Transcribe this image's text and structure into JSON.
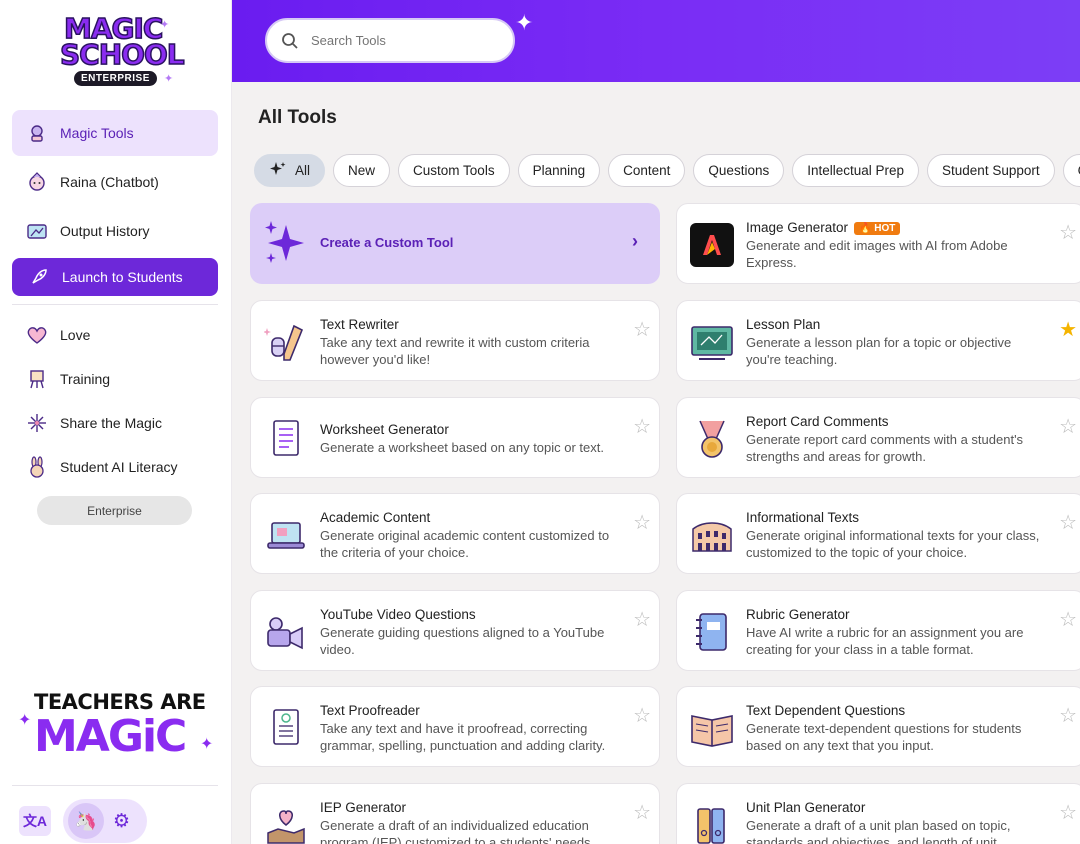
{
  "logo": {
    "line1": "MAGIC",
    "line2": "SCHOOL",
    "badge": "ENTERPRISE"
  },
  "sidebar": {
    "items": [
      {
        "label": "Magic Tools",
        "icon": "magic-tools-icon"
      },
      {
        "label": "Raina (Chatbot)",
        "icon": "raina-icon"
      },
      {
        "label": "Output History",
        "icon": "output-history-icon"
      },
      {
        "label": "Launch to Students",
        "icon": "rocket-icon"
      }
    ],
    "links": [
      {
        "label": "Love",
        "icon": "heart-icon"
      },
      {
        "label": "Training",
        "icon": "easel-icon"
      },
      {
        "label": "Share the Magic",
        "icon": "firework-icon"
      },
      {
        "label": "Student AI Literacy",
        "icon": "bunny-icon"
      }
    ],
    "enterprise_label": "Enterprise",
    "promo": {
      "line1": "TEACHERS ARE",
      "line2": "MAGiC"
    }
  },
  "search": {
    "placeholder": "Search Tools"
  },
  "page_title": "All Tools",
  "filters": [
    "All",
    "New",
    "Custom Tools",
    "Planning",
    "Content",
    "Questions",
    "Intellectual Prep",
    "Student Support",
    "C"
  ],
  "create_card": {
    "label": "Create a Custom Tool"
  },
  "tools_left": [
    {
      "title": "Text Rewriter",
      "desc": "Take any text and rewrite it with custom criteria however you'd like!",
      "favorite": false
    },
    {
      "title": "Worksheet Generator",
      "desc": "Generate a worksheet based on any topic or text.",
      "favorite": false
    },
    {
      "title": "Academic Content",
      "desc": "Generate original academic content customized to the criteria of your choice.",
      "favorite": false
    },
    {
      "title": "YouTube Video Questions",
      "desc": "Generate guiding questions aligned to a YouTube video.",
      "favorite": false
    },
    {
      "title": "Text Proofreader",
      "desc": "Take any text and have it proofread, correcting grammar, spelling, punctuation and adding clarity.",
      "favorite": false
    },
    {
      "title": "IEP Generator",
      "desc": "Generate a draft of an individualized education program (IEP) customized to a students' needs.",
      "favorite": false
    }
  ],
  "tools_right": [
    {
      "title": "Image Generator",
      "badge": "HOT",
      "desc": "Generate and edit images with AI from Adobe Express.",
      "favorite": false
    },
    {
      "title": "Lesson Plan",
      "desc": "Generate a lesson plan for a topic or objective you're teaching.",
      "favorite": true
    },
    {
      "title": "Report Card Comments",
      "desc": "Generate report card comments with a student's strengths and areas for growth.",
      "favorite": false
    },
    {
      "title": "Informational Texts",
      "desc": "Generate original informational texts for your class, customized to the topic of your choice.",
      "favorite": false
    },
    {
      "title": "Rubric Generator",
      "desc": "Have AI write a rubric for an assignment you are creating for your class in a table format.",
      "favorite": false
    },
    {
      "title": "Text Dependent Questions",
      "desc": "Generate text-dependent questions for students based on any text that you input.",
      "favorite": false
    },
    {
      "title": "Unit Plan Generator",
      "desc": "Generate a draft of a unit plan based on topic, standards and objectives, and length of unit.",
      "favorite": false
    }
  ],
  "colors": {
    "accent": "#6d28d9",
    "header_start": "#6a1cf0",
    "active_bg": "#ede2fd",
    "hot": "#f07b10",
    "star_on": "#f5b400"
  }
}
